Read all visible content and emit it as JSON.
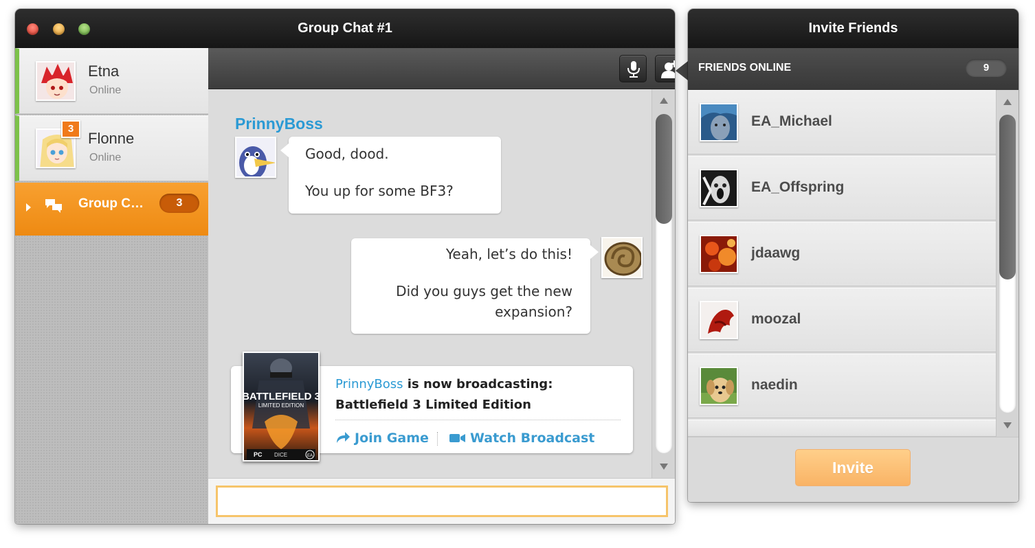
{
  "chat_window": {
    "title": "Group Chat #1",
    "contacts": [
      {
        "name": "Etna",
        "status": "Online"
      },
      {
        "name": "Flonne",
        "status": "Online",
        "badge": "3"
      }
    ],
    "group": {
      "label": "Group C…",
      "count": "3"
    },
    "toolbar": {
      "mic_icon": "microphone-icon",
      "add_user_icon": "add-user-icon"
    },
    "messages": {
      "sender": "PrinnyBoss",
      "incoming": [
        "Good, dood.",
        "You up for some BF3?"
      ],
      "outgoing": [
        "Yeah, let’s do this!",
        "Did you guys get the new",
        "expansion?"
      ]
    },
    "broadcast": {
      "user": "PrinnyBoss",
      "status_text": " is now broadcasting:",
      "game": "Battlefield 3 Limited Edition",
      "join_label": "Join Game",
      "watch_label": "Watch Broadcast",
      "cover_title": "BATTLEFIELD 3",
      "cover_subtitle": "LIMITED EDITION",
      "cover_platform": "PC",
      "cover_dice": "DICE",
      "cover_ea": "EA"
    },
    "input": {
      "value": "",
      "placeholder": ""
    }
  },
  "invite_window": {
    "title": "Invite Friends",
    "friends_online_label": "FRIENDS ONLINE",
    "friends_online_count": "9",
    "friends": [
      "EA_Michael",
      "EA_Offspring",
      "jdaawg",
      "moozal",
      "naedin"
    ],
    "invite_label": "Invite"
  },
  "colors": {
    "accent_orange": "#ee8a12",
    "online_green": "#7dc24a",
    "link_blue": "#2b9ad4",
    "invite_button": "#f9b365"
  }
}
